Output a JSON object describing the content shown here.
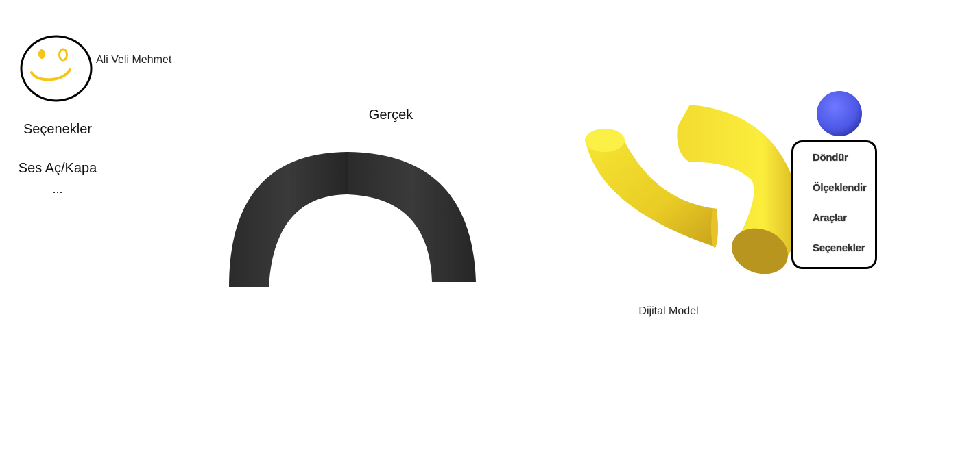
{
  "user": {
    "name": "Ali Veli Mehmet",
    "avatar_icon": "smiley-face-icon"
  },
  "left_menu": {
    "options_label": "Seçenekler",
    "sound_label": "Ses Aç/Kapa",
    "more_label": "..."
  },
  "real": {
    "title": "Gerçek",
    "model_color": "#333333"
  },
  "digital": {
    "title": "Dijital Model",
    "model_color": "#f5e23a",
    "sphere_color": "#5560f0"
  },
  "context_menu": {
    "items": [
      {
        "label": "Döndür"
      },
      {
        "label": "Ölçeklendir"
      },
      {
        "label": "Araçlar"
      },
      {
        "label": "Seçenekler"
      }
    ]
  }
}
